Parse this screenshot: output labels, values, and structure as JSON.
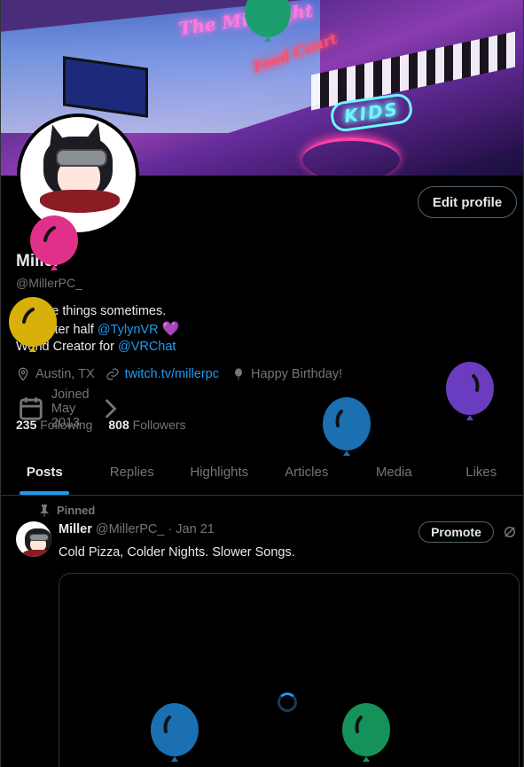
{
  "banner": {
    "neon_signs": [
      "The Midnight",
      "Food Court",
      "KIDS"
    ]
  },
  "profile": {
    "name": "Miller",
    "handle": "@MillerPC_",
    "edit_button": "Edit profile",
    "bio_line1": "I create things sometimes.",
    "bio_line2_prefix": "My better half ",
    "bio_line2_link": "@TylynVR",
    "bio_line2_emoji": "💜",
    "bio_line3_prefix": "World Creator for ",
    "bio_line3_link": "@VRChat",
    "location": "Austin, TX",
    "website": "twitch.tv/millerpc",
    "birthday": "Happy Birthday!",
    "joined": "Joined May 2013",
    "following_count": "235",
    "following_label": "Following",
    "followers_count": "808",
    "followers_label": "Followers"
  },
  "tabs": [
    "Posts",
    "Replies",
    "Highlights",
    "Articles",
    "Media",
    "Likes"
  ],
  "post": {
    "pinned_label": "Pinned",
    "author_name": "Miller",
    "author_handle": "@MillerPC_",
    "separator": "·",
    "date": "Jan 21",
    "text": "Cold Pizza, Colder Nights. Slower Songs.",
    "promote_button": "Promote"
  },
  "colors": {
    "accent": "#1d9bf0",
    "balloons": [
      "#1d9e6e",
      "#e0308a",
      "#d8b00a",
      "#6a3cc0",
      "#1a70b0",
      "#1a70b0",
      "#14925a"
    ]
  },
  "icons": [
    "location-icon",
    "link-icon",
    "balloon-icon",
    "calendar-icon",
    "chevron-right-icon",
    "pin-icon",
    "grok-icon"
  ]
}
